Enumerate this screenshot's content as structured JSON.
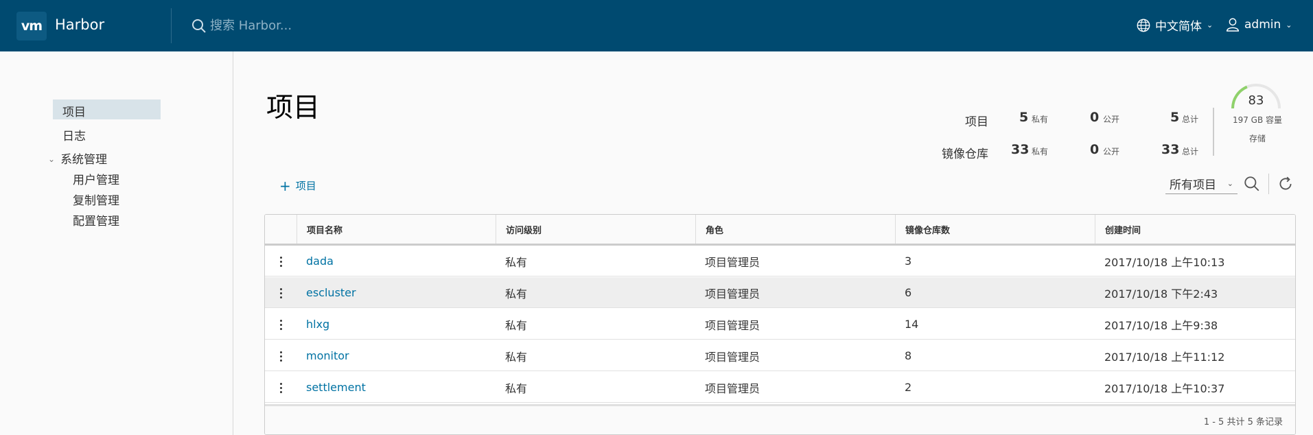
{
  "header": {
    "logo": "vm",
    "brand": "Harbor",
    "search_placeholder": "搜索 Harbor...",
    "language": "中文简体",
    "user": "admin"
  },
  "sidebar": {
    "items": [
      {
        "label": "项目"
      },
      {
        "label": "日志"
      },
      {
        "label": "系统管理"
      },
      {
        "label": "用户管理"
      },
      {
        "label": "复制管理"
      },
      {
        "label": "配置管理"
      }
    ]
  },
  "main": {
    "title": "项目",
    "stats": {
      "projects_label": "项目",
      "repos_label": "镜像仓库",
      "private_unit": "私有",
      "public_unit": "公开",
      "total_unit": "总计",
      "projects_private": "5",
      "projects_public": "0",
      "projects_total": "5",
      "repos_private": "33",
      "repos_public": "0",
      "repos_total": "33"
    },
    "storage": {
      "percent": "83",
      "capacity": "197 GB 容量",
      "label": "存储"
    },
    "add_project_label": "项目",
    "filter_value": "所有项目"
  },
  "table": {
    "columns": [
      "项目名称",
      "访问级别",
      "角色",
      "镜像仓库数",
      "创建时间"
    ],
    "rows": [
      {
        "name": "dada",
        "access": "私有",
        "role": "项目管理员",
        "repos": "3",
        "created": "2017/10/18 上午10:13"
      },
      {
        "name": "escluster",
        "access": "私有",
        "role": "项目管理员",
        "repos": "6",
        "created": "2017/10/18 下午2:43"
      },
      {
        "name": "hlxg",
        "access": "私有",
        "role": "项目管理员",
        "repos": "14",
        "created": "2017/10/18 上午9:38"
      },
      {
        "name": "monitor",
        "access": "私有",
        "role": "项目管理员",
        "repos": "8",
        "created": "2017/10/18 上午11:12"
      },
      {
        "name": "settlement",
        "access": "私有",
        "role": "项目管理员",
        "repos": "2",
        "created": "2017/10/18 上午10:37"
      }
    ],
    "footer": "1 - 5 共计 5 条记录"
  },
  "colors": {
    "header_bg": "#004a70",
    "link": "#0072a3",
    "gauge_fill": "#8fd16b",
    "gauge_track": "#e6e6e6"
  }
}
